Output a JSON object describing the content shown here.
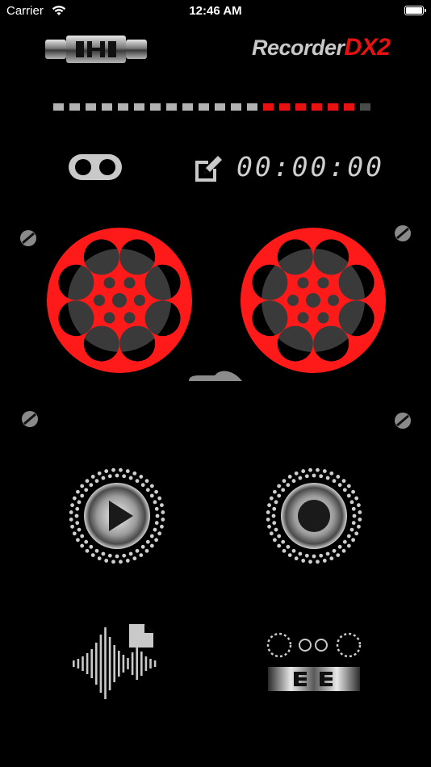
{
  "status_bar": {
    "carrier": "Carrier",
    "time": "12:46 AM",
    "wifi_icon": "wifi-icon",
    "battery_icon": "battery-icon"
  },
  "header": {
    "brand_word": "Recorder",
    "brand_accent": "DX2",
    "logo_icon": "tape-connector-icon"
  },
  "level_meter": {
    "segments": 20,
    "lit_gray": 13,
    "lit_red": 6,
    "colors": {
      "gray": "#b3b3b3",
      "red": "#e81010",
      "dim": "#4a4a4a"
    }
  },
  "controls": {
    "timer": "00:00:00",
    "toggle_icon": "toggle-icon",
    "edit_icon": "edit-icon"
  },
  "reels": {
    "color": "#ff1a1a",
    "hub_color": "#3a3a3a"
  },
  "buttons": {
    "play": "play-button",
    "record": "record-button",
    "files": "audio-files-button",
    "settings": "tape-deck-button"
  },
  "colors": {
    "accent": "#e81010",
    "background": "#000000",
    "metal": "#9a9a9a"
  }
}
